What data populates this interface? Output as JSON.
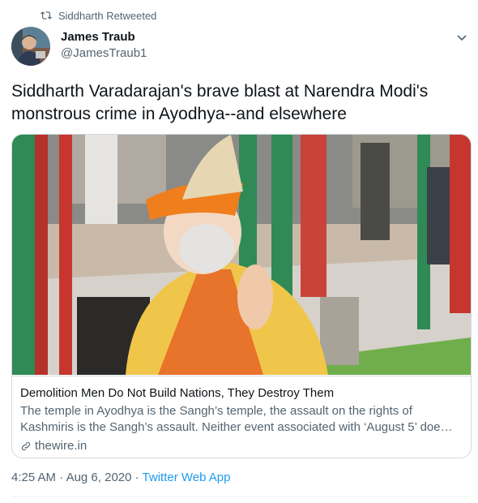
{
  "retweet": {
    "label": "Siddharth Retweeted"
  },
  "author": {
    "name": "James Traub",
    "handle": "@JamesTraub1"
  },
  "tweet": {
    "text": "Siddharth Varadarajan's brave blast at Narendra Modi's monstrous crime in Ayodhya--and elsewhere"
  },
  "card": {
    "title": "Demolition Men Do Not Build Nations, They Destroy Them",
    "description": "The temple in Ayodhya is the Sangh’s temple, the assault on the rights of Kashmiris is the Sangh’s assault. Neither event associated with ‘August 5’ doe…",
    "domain": "thewire.in"
  },
  "meta": {
    "time": "4:25 AM",
    "sep1": " · ",
    "date": "Aug 6, 2020",
    "sep2": " · ",
    "app": "Twitter Web App"
  },
  "colors": {
    "link": "#1d9bf0",
    "muted": "#536471",
    "border": "#cfd9de"
  },
  "icons": {
    "retweet": "retweet-icon",
    "more": "chevron-down-icon",
    "link": "link-icon"
  }
}
